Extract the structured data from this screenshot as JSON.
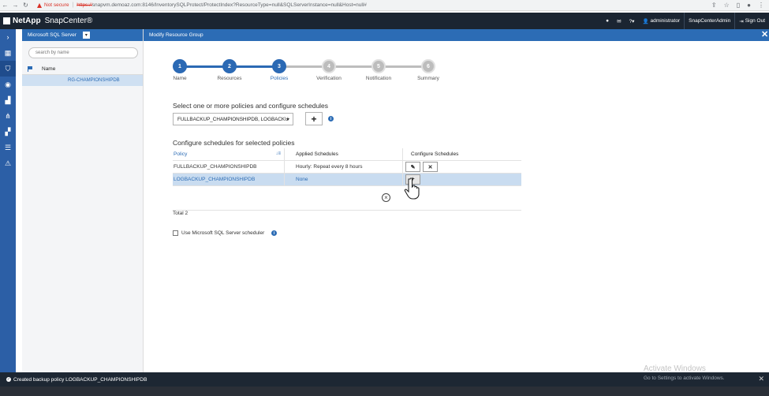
{
  "browser": {
    "security_label": "Not secure",
    "url_scheme": "https://",
    "url_rest": "snapvm.demoaz.com:8146/InventorySQLProtect/ProtectIndex?ResourceType=null&SQLServerInstance=null&Host=null#"
  },
  "header": {
    "brand": "NetApp",
    "product": "SnapCenter®",
    "user": "administrator",
    "role": "SnapCenterAdmin",
    "signout": "Sign Out"
  },
  "sidebar_list": {
    "plugin": "Microsoft SQL Server",
    "search_placeholder": "search by name",
    "col_name": "Name",
    "items": [
      "RG-CHAMPIONSHIPDB"
    ]
  },
  "main": {
    "title": "Modify Resource Group",
    "steps": [
      {
        "num": "1",
        "label": "Name",
        "state": "done"
      },
      {
        "num": "2",
        "label": "Resources",
        "state": "done"
      },
      {
        "num": "3",
        "label": "Policies",
        "state": "active"
      },
      {
        "num": "4",
        "label": "Verification",
        "state": "todo"
      },
      {
        "num": "5",
        "label": "Notification",
        "state": "todo"
      },
      {
        "num": "6",
        "label": "Summary",
        "state": "todo"
      }
    ],
    "policy_section_title": "Select one or more policies and configure schedules",
    "policy_select_value": "FULLBACKUP_CHAMPIONSHIPDB, LOGBACKU",
    "schedules_title": "Configure schedules for selected policies",
    "table": {
      "headers": [
        "Policy",
        "Applied Schedules",
        "Configure Schedules"
      ],
      "rows": [
        {
          "policy": "FULLBACKUP_CHAMPIONSHIPDB",
          "schedule": "Hourly: Repeat every 8 hours"
        },
        {
          "policy": "LOGBACKUP_CHAMPIONSHIPDB",
          "schedule": "None"
        }
      ]
    },
    "total": "Total 2",
    "checkbox_label": "Use Microsoft SQL Server scheduler",
    "watermark_title": "Activate Windows"
  },
  "notification": {
    "text": "Created backup policy LOGBACKUP_CHAMPIONSHIPDB",
    "watermark": "Go to Settings to activate Windows."
  },
  "colors": {
    "accent": "#2c6cb5",
    "header_dark": "#1b2532",
    "step_done": "#2b69b4",
    "step_todo": "#bdbdbd",
    "selected_row": "#c9dcf0"
  }
}
